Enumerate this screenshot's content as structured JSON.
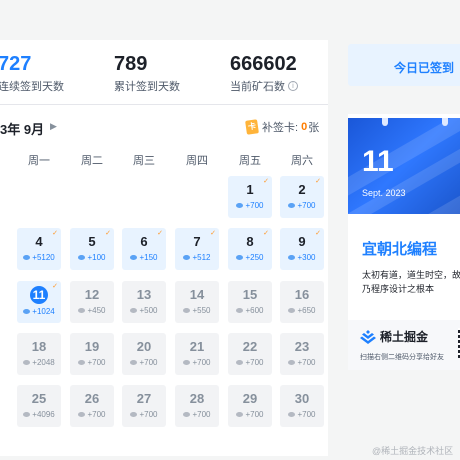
{
  "stats": [
    {
      "value": "727",
      "label": "连续签到天数",
      "highlight": true
    },
    {
      "value": "789",
      "label": "累计签到天数",
      "highlight": false
    },
    {
      "value": "666602",
      "label": "当前矿石数",
      "info_icon": true
    }
  ],
  "calendar": {
    "month_label": "3年 9月",
    "makeup_label": "补签卡:",
    "makeup_count": "0",
    "makeup_unit": "张",
    "weekdays": [
      "周一",
      "周二",
      "周三",
      "周四",
      "周五",
      "周六"
    ],
    "rows": [
      [
        null,
        null,
        null,
        null,
        {
          "day": "1",
          "reward": "+700",
          "status": "signed"
        },
        {
          "day": "2",
          "reward": "+700",
          "status": "signed"
        }
      ],
      [
        {
          "day": "4",
          "reward": "+5120",
          "status": "signed"
        },
        {
          "day": "5",
          "reward": "+100",
          "status": "signed"
        },
        {
          "day": "6",
          "reward": "+150",
          "status": "signed"
        },
        {
          "day": "7",
          "reward": "+512",
          "status": "signed"
        },
        {
          "day": "8",
          "reward": "+250",
          "status": "signed"
        },
        {
          "day": "9",
          "reward": "+300",
          "status": "signed"
        }
      ],
      [
        {
          "day": "11",
          "reward": "+1024",
          "status": "today"
        },
        {
          "day": "12",
          "reward": "+450",
          "status": "unsigned"
        },
        {
          "day": "13",
          "reward": "+500",
          "status": "unsigned"
        },
        {
          "day": "14",
          "reward": "+550",
          "status": "unsigned"
        },
        {
          "day": "15",
          "reward": "+600",
          "status": "unsigned"
        },
        {
          "day": "16",
          "reward": "+650",
          "status": "unsigned"
        }
      ],
      [
        {
          "day": "18",
          "reward": "+2048",
          "status": "unsigned"
        },
        {
          "day": "19",
          "reward": "+700",
          "status": "unsigned"
        },
        {
          "day": "20",
          "reward": "+700",
          "status": "unsigned"
        },
        {
          "day": "21",
          "reward": "+700",
          "status": "unsigned"
        },
        {
          "day": "22",
          "reward": "+700",
          "status": "unsigned"
        },
        {
          "day": "23",
          "reward": "+700",
          "status": "unsigned"
        }
      ],
      [
        {
          "day": "25",
          "reward": "+4096",
          "status": "unsigned"
        },
        {
          "day": "26",
          "reward": "+700",
          "status": "unsigned"
        },
        {
          "day": "27",
          "reward": "+700",
          "status": "unsigned"
        },
        {
          "day": "28",
          "reward": "+700",
          "status": "unsigned"
        },
        {
          "day": "29",
          "reward": "+700",
          "status": "unsigned"
        },
        {
          "day": "30",
          "reward": "+700",
          "status": "unsigned"
        }
      ]
    ]
  },
  "signin": {
    "label": "今日已签到"
  },
  "daily": {
    "day": "11",
    "month": "Sept. 2023",
    "fortune_title": "宜朝北编程",
    "fortune_lines": [
      "太初有道，道生时空，故",
      "乃程序设计之根本"
    ],
    "brand_name": "稀土掘金",
    "qr_hint": "扫描右侧二维码分享给好友"
  },
  "watermark": "@稀土掘金技术社区",
  "colors": {
    "accent": "#1e80ff",
    "check": "#ff9a2e",
    "makeup": "#ff7d00"
  }
}
